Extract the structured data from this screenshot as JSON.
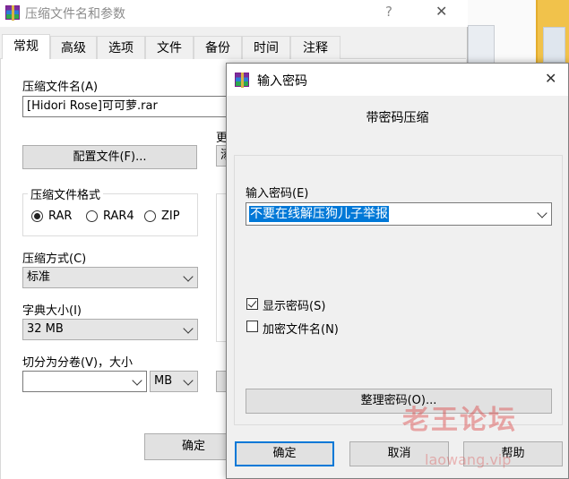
{
  "main_window": {
    "title": "压缩文件名和参数",
    "help_glyph": "?",
    "close_glyph": "✕",
    "tabs": [
      {
        "label": "常规",
        "active": true
      },
      {
        "label": "高级"
      },
      {
        "label": "选项"
      },
      {
        "label": "文件"
      },
      {
        "label": "备份"
      },
      {
        "label": "时间"
      },
      {
        "label": "注释"
      }
    ],
    "archive_name_label": "压缩文件名(A)",
    "archive_name_value": "[Hidori Rose]可可萝.rar",
    "profiles_button": "配置文件(F)...",
    "update_label_partial": "更",
    "update_value_partial": "添",
    "format_group_label": "压缩文件格式",
    "formats": [
      {
        "label": "RAR",
        "selected": true
      },
      {
        "label": "RAR4",
        "selected": false
      },
      {
        "label": "ZIP",
        "selected": false
      }
    ],
    "method_label": "压缩方式(C)",
    "method_value": "标准",
    "dict_label": "字典大小(I)",
    "dict_value": "32 MB",
    "split_label": "切分为分卷(V)，大小",
    "split_value": "",
    "split_unit": "MB",
    "ok_button": "确定"
  },
  "password_dialog": {
    "title": "输入密码",
    "close_glyph": "✕",
    "heading": "带密码压缩",
    "enter_label": "输入密码(E)",
    "password_value": "不要在线解压狗儿子举报",
    "show_password_label": "显示密码(S)",
    "show_password_checked": true,
    "encrypt_names_label": "加密文件名(N)",
    "encrypt_names_checked": false,
    "organize_button": "整理密码(O)...",
    "ok_button": "确定",
    "cancel_button": "取消",
    "help_button": "帮助"
  },
  "watermark": {
    "text": "老王论坛",
    "url": "laowang.vip"
  },
  "colors": {
    "accent": "#0078d7",
    "watermark": "#dc4646"
  }
}
